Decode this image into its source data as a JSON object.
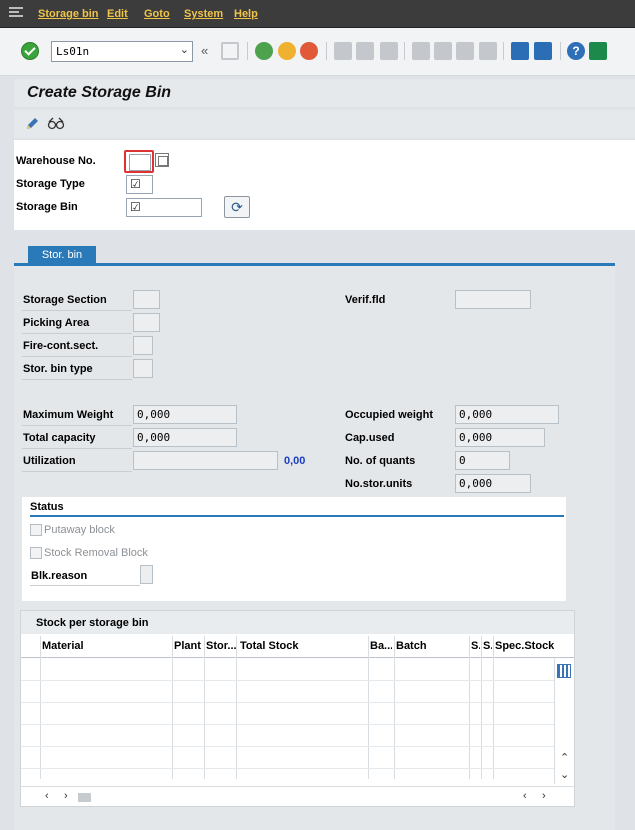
{
  "menu": {
    "items": [
      "Storage bin",
      "Edit",
      "Goto",
      "System",
      "Help"
    ]
  },
  "toolbar": {
    "command_field": "Ls01n"
  },
  "title": "Create Storage Bin",
  "header": {
    "warehouse_label": "Warehouse No.",
    "storage_type_label": "Storage Type",
    "storage_bin_label": "Storage Bin"
  },
  "tab": {
    "label": "Stor. bin"
  },
  "fields": {
    "storage_section": "Storage Section",
    "picking_area": "Picking Area",
    "fire_cont": "Fire-cont.sect.",
    "bin_type": "Stor. bin type",
    "verif_fld": "Verif.fld",
    "max_weight_label": "Maximum Weight",
    "max_weight_value": "0,000",
    "total_capacity_label": "Total capacity",
    "total_capacity_value": "0,000",
    "utilization_label": "Utilization",
    "utilization_value": "0,00",
    "occupied_weight_label": "Occupied weight",
    "occupied_weight_value": "0,000",
    "cap_used_label": "Cap.used",
    "cap_used_value": "0,000",
    "quants_label": "No. of quants",
    "quants_value": "0",
    "stor_units_label": "No.stor.units",
    "stor_units_value": "0,000"
  },
  "status": {
    "title": "Status",
    "putaway_block": "Putaway block",
    "removal_block": "Stock Removal Block",
    "blk_reason": "Blk.reason"
  },
  "stock_table": {
    "title": "Stock per storage bin",
    "columns": [
      "Material",
      "Plant",
      "Stor...",
      "Total Stock",
      "Ba...",
      "Batch",
      "S.",
      "S.",
      "Spec.Stock No"
    ]
  }
}
